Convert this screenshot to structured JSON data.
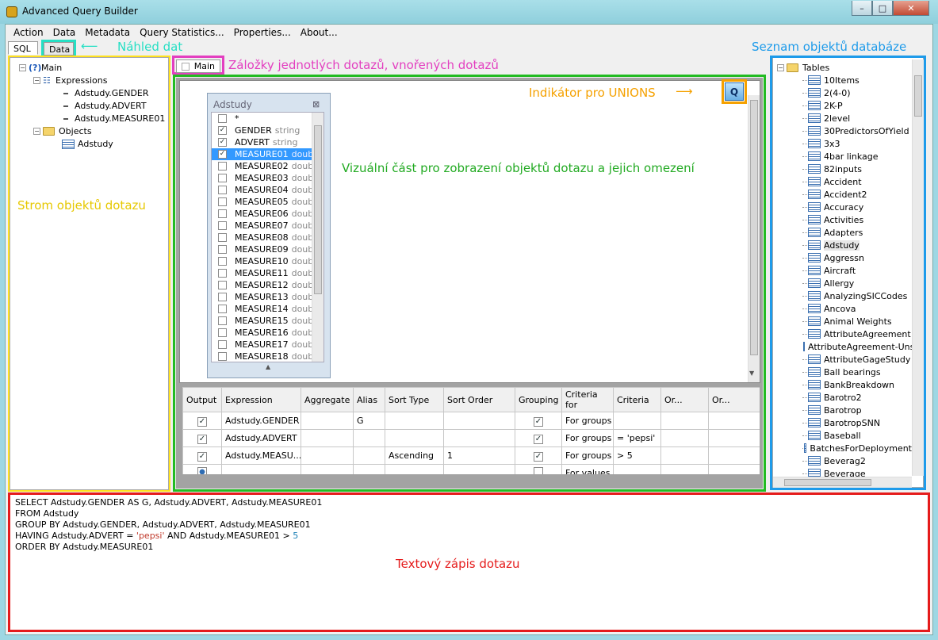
{
  "window": {
    "title": "Advanced Query Builder",
    "min": "–",
    "max": "□",
    "close": "✕"
  },
  "menu": [
    "Action",
    "Data",
    "Metadata",
    "Query Statistics...",
    "Properties...",
    "About..."
  ],
  "tabs": {
    "sql": "SQL",
    "data": "Data"
  },
  "annotations": {
    "data_preview": "Náhled dat",
    "db_objects": "Seznam objektů databáze",
    "query_tabs": "Záložky jednotlých dotazů, vnořených dotazů",
    "query_tree": "Strom objektů dotazu",
    "union_indicator": "Indikátor pro UNIONS",
    "visual_part": "Vizuální část pro zobrazení objektů dotazu a jejich omezení",
    "text_query": "Textový zápis dotazu"
  },
  "query_tree": {
    "root": "Main",
    "expressions_label": "Expressions",
    "expressions": [
      "Adstudy.GENDER",
      "Adstudy.ADVERT",
      "Adstudy.MEASURE01"
    ],
    "objects_label": "Objects",
    "objects": [
      "Adstudy"
    ]
  },
  "subquery_tab": "Main",
  "union_button": "Q",
  "table_box": {
    "title": "Adstudy",
    "close": "⊠",
    "fields": [
      {
        "name": "*",
        "type": "",
        "checked": false,
        "selected": false
      },
      {
        "name": "GENDER",
        "type": "string",
        "checked": true,
        "selected": false
      },
      {
        "name": "ADVERT",
        "type": "string",
        "checked": true,
        "selected": false
      },
      {
        "name": "MEASURE01",
        "type": "doub",
        "checked": true,
        "selected": true
      },
      {
        "name": "MEASURE02",
        "type": "doub",
        "checked": false,
        "selected": false
      },
      {
        "name": "MEASURE03",
        "type": "doub",
        "checked": false,
        "selected": false
      },
      {
        "name": "MEASURE04",
        "type": "doub",
        "checked": false,
        "selected": false
      },
      {
        "name": "MEASURE05",
        "type": "doub",
        "checked": false,
        "selected": false
      },
      {
        "name": "MEASURE06",
        "type": "doub",
        "checked": false,
        "selected": false
      },
      {
        "name": "MEASURE07",
        "type": "doub",
        "checked": false,
        "selected": false
      },
      {
        "name": "MEASURE08",
        "type": "doub",
        "checked": false,
        "selected": false
      },
      {
        "name": "MEASURE09",
        "type": "doub",
        "checked": false,
        "selected": false
      },
      {
        "name": "MEASURE10",
        "type": "doub",
        "checked": false,
        "selected": false
      },
      {
        "name": "MEASURE11",
        "type": "doub",
        "checked": false,
        "selected": false
      },
      {
        "name": "MEASURE12",
        "type": "doub",
        "checked": false,
        "selected": false
      },
      {
        "name": "MEASURE13",
        "type": "doub",
        "checked": false,
        "selected": false
      },
      {
        "name": "MEASURE14",
        "type": "doub",
        "checked": false,
        "selected": false
      },
      {
        "name": "MEASURE15",
        "type": "doub",
        "checked": false,
        "selected": false
      },
      {
        "name": "MEASURE16",
        "type": "doub",
        "checked": false,
        "selected": false
      },
      {
        "name": "MEASURE17",
        "type": "doub",
        "checked": false,
        "selected": false
      },
      {
        "name": "MEASURE18",
        "type": "doub",
        "checked": false,
        "selected": false
      }
    ]
  },
  "grid": {
    "headers": [
      "Output",
      "Expression",
      "Aggregate",
      "Alias",
      "Sort Type",
      "Sort Order",
      "Grouping",
      "Criteria for",
      "Criteria",
      "Or...",
      "Or..."
    ],
    "rows": [
      {
        "output": "checked",
        "expression": "Adstudy.GENDER",
        "aggregate": "",
        "alias": "G",
        "sort_type": "",
        "sort_order": "",
        "grouping": true,
        "criteria_for": "For groups",
        "criteria": "",
        "or1": "",
        "or2": ""
      },
      {
        "output": "checked",
        "expression": "Adstudy.ADVERT",
        "aggregate": "",
        "alias": "",
        "sort_type": "",
        "sort_order": "",
        "grouping": true,
        "criteria_for": "For groups",
        "criteria": "= 'pepsi'",
        "or1": "",
        "or2": ""
      },
      {
        "output": "checked",
        "expression": "Adstudy.MEASU...",
        "aggregate": "",
        "alias": "",
        "sort_type": "Ascending",
        "sort_order": "1",
        "grouping": true,
        "criteria_for": "For groups",
        "criteria": "> 5",
        "or1": "",
        "or2": ""
      },
      {
        "output": "indeterminate",
        "expression": "",
        "aggregate": "",
        "alias": "",
        "sort_type": "",
        "sort_order": "",
        "grouping": false,
        "criteria_for": "For values",
        "criteria": "",
        "or1": "",
        "or2": ""
      }
    ]
  },
  "db_objects": {
    "root": "Tables",
    "tables": [
      "10Items",
      "2(4-0)",
      "2K-P",
      "2level",
      "30PredictorsOfYield",
      "3x3",
      "4bar linkage",
      "82inputs",
      "Accident",
      "Accident2",
      "Accuracy",
      "Activities",
      "Adapters",
      "Adstudy",
      "Aggressn",
      "Aircraft",
      "Allergy",
      "AnalyzingSICCodes",
      "Ancova",
      "Animal Weights",
      "AttributeAgreement",
      "AttributeAgreement-Unst",
      "AttributeGageStudy",
      "Ball bearings",
      "BankBreakdown",
      "Barotro2",
      "Barotrop",
      "BarotropSNN",
      "Baseball",
      "BatchesForDeployment",
      "Beverag2",
      "Beverage"
    ],
    "selected": "Adstudy"
  },
  "sql": [
    [
      {
        "t": "SELECT Adstudy.GENDER AS G, Adstudy.ADVERT, Adstudy.MEASURE01",
        "c": "#000"
      }
    ],
    [
      {
        "t": "FROM Adstudy",
        "c": "#000"
      }
    ],
    [
      {
        "t": "GROUP BY Adstudy.GENDER, Adstudy.ADVERT, Adstudy.MEASURE01",
        "c": "#000"
      }
    ],
    [
      {
        "t": "HAVING Adstudy.ADVERT = ",
        "c": "#000"
      },
      {
        "t": "'pepsi'",
        "c": "#c0392b"
      },
      {
        "t": " AND Adstudy.MEASURE01 > ",
        "c": "#000"
      },
      {
        "t": "5",
        "c": "#1a7fb5"
      }
    ],
    [
      {
        "t": "ORDER BY Adstudy.MEASURE01",
        "c": "#000"
      }
    ]
  ],
  "colors": {
    "yellow": "#ffe11f",
    "green": "#22bb22",
    "blue": "#1e9bea",
    "red": "#e51b1b",
    "magenta": "#e33fc0",
    "cyan": "#25dfc4",
    "orange": "#f5a100",
    "selection": "#3399ff"
  }
}
